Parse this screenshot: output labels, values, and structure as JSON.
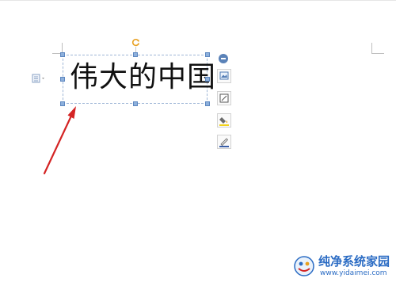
{
  "document": {
    "textbox_content": "伟大的中国"
  },
  "floating_toolbar": {
    "tools": [
      {
        "name": "layout-options-icon"
      },
      {
        "name": "shape-outline-icon"
      },
      {
        "name": "fill-color-icon"
      },
      {
        "name": "line-color-icon"
      }
    ]
  },
  "watermark": {
    "title": "纯净系统家园",
    "url": "www.yidaimei.com"
  },
  "colors": {
    "selection_handle": "#8db0dc",
    "annotation_arrow": "#d42424",
    "watermark_text": "#2b6cc4",
    "rotate_handle": "#e8a020"
  },
  "icons": {
    "rotate": "rotate-icon",
    "paragraph": "paragraph-icon",
    "collapse": "collapse-icon"
  }
}
